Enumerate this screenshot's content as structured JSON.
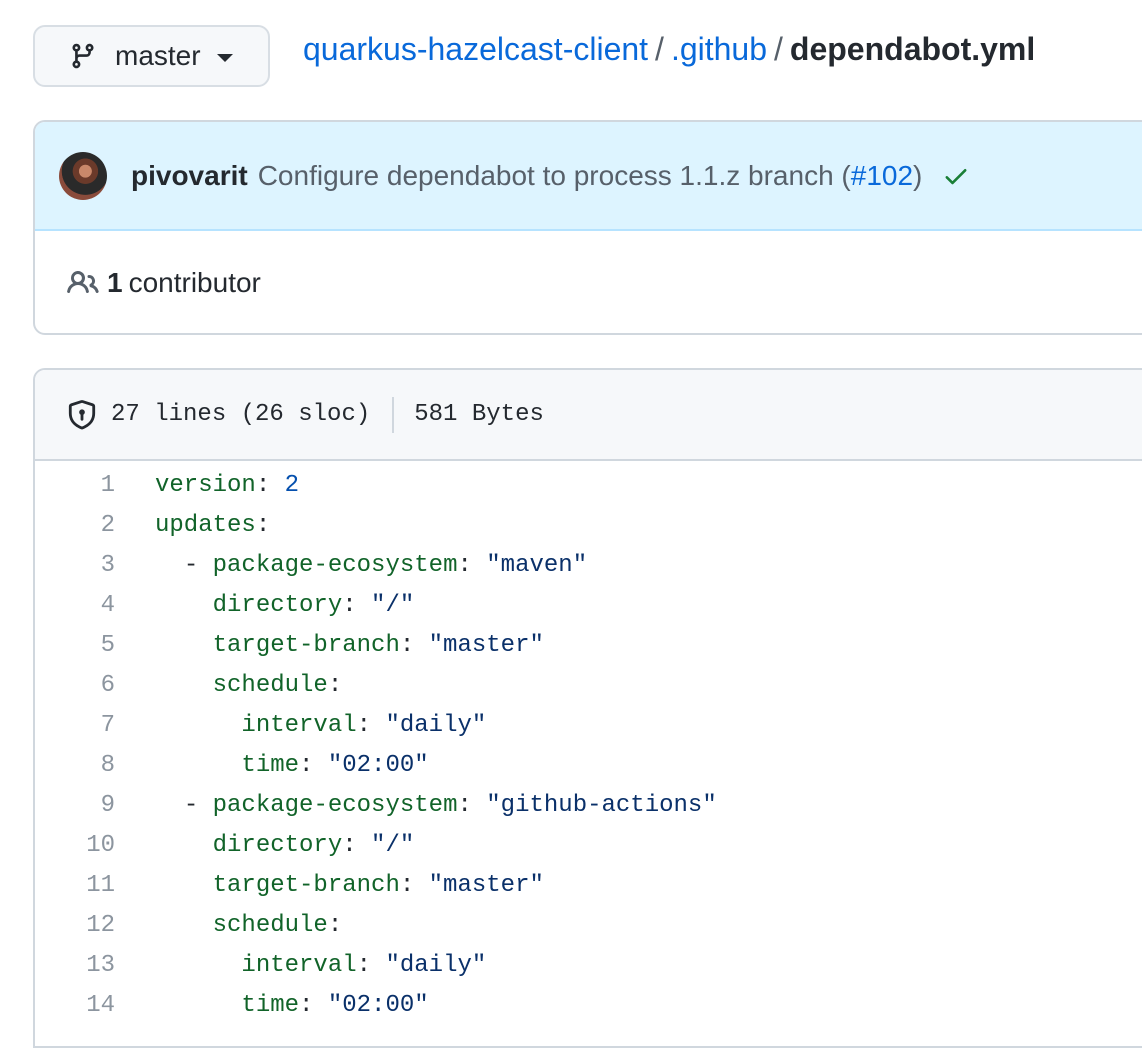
{
  "branch": {
    "name": "master"
  },
  "breadcrumb": {
    "repo": "quarkus-hazelcast-client",
    "folder": ".github",
    "file": "dependabot.yml",
    "separator": "/"
  },
  "commit": {
    "author": "pivovarit",
    "message_prefix": "Configure dependabot to process 1.1.z branch (",
    "pr_link": "#102",
    "message_suffix": ")",
    "status": "success"
  },
  "contributors": {
    "count": "1",
    "label": "contributor"
  },
  "file_info": {
    "lines": "27 lines (26 sloc)",
    "size": "581 Bytes"
  },
  "code_lines": [
    {
      "num": "1",
      "indent": "",
      "dash": "",
      "key": "version",
      "colon": ":",
      "val": "2",
      "val_type": "n"
    },
    {
      "num": "2",
      "indent": "",
      "dash": "",
      "key": "updates",
      "colon": ":",
      "val": "",
      "val_type": "s"
    },
    {
      "num": "3",
      "indent": "  ",
      "dash": "- ",
      "key": "package-ecosystem",
      "colon": ":",
      "val": "\"maven\"",
      "val_type": "s"
    },
    {
      "num": "4",
      "indent": "    ",
      "dash": "",
      "key": "directory",
      "colon": ":",
      "val": "\"/\"",
      "val_type": "s"
    },
    {
      "num": "5",
      "indent": "    ",
      "dash": "",
      "key": "target-branch",
      "colon": ":",
      "val": "\"master\"",
      "val_type": "s"
    },
    {
      "num": "6",
      "indent": "    ",
      "dash": "",
      "key": "schedule",
      "colon": ":",
      "val": "",
      "val_type": "s"
    },
    {
      "num": "7",
      "indent": "      ",
      "dash": "",
      "key": "interval",
      "colon": ":",
      "val": "\"daily\"",
      "val_type": "s"
    },
    {
      "num": "8",
      "indent": "      ",
      "dash": "",
      "key": "time",
      "colon": ":",
      "val": "\"02:00\"",
      "val_type": "s"
    },
    {
      "num": "9",
      "indent": "  ",
      "dash": "- ",
      "key": "package-ecosystem",
      "colon": ":",
      "val": "\"github-actions\"",
      "val_type": "s"
    },
    {
      "num": "10",
      "indent": "    ",
      "dash": "",
      "key": "directory",
      "colon": ":",
      "val": "\"/\"",
      "val_type": "s"
    },
    {
      "num": "11",
      "indent": "    ",
      "dash": "",
      "key": "target-branch",
      "colon": ":",
      "val": "\"master\"",
      "val_type": "s"
    },
    {
      "num": "12",
      "indent": "    ",
      "dash": "",
      "key": "schedule",
      "colon": ":",
      "val": "",
      "val_type": "s"
    },
    {
      "num": "13",
      "indent": "      ",
      "dash": "",
      "key": "interval",
      "colon": ":",
      "val": "\"daily\"",
      "val_type": "s"
    },
    {
      "num": "14",
      "indent": "      ",
      "dash": "",
      "key": "time",
      "colon": ":",
      "val": "\"02:00\"",
      "val_type": "s"
    }
  ],
  "colors": {
    "link": "#0969da",
    "commit_bg": "#ddf4ff",
    "success": "#1a7f37",
    "yaml_key": "#116329",
    "yaml_string": "#0a3069",
    "yaml_number": "#0550ae"
  },
  "icons": {
    "branch": "git-branch-icon",
    "caret": "caret-down-icon",
    "check": "check-icon",
    "people": "people-icon",
    "shield": "shield-icon"
  }
}
